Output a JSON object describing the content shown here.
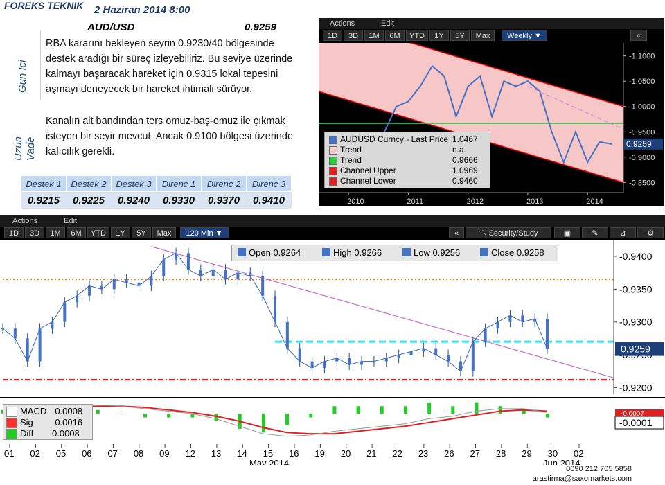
{
  "header": {
    "brand": "FOREKS TEKNIK",
    "date": "2 Haziran 2014 8:00",
    "pair": "AUD/USD",
    "price": "0.9259"
  },
  "sections": {
    "short_label": "Gun Ici",
    "long_label": "Uzun Vade"
  },
  "commentary": {
    "short": [
      "RBA kararını bekleyen seyrin 0.9230/40 bölgesinde",
      "destek aradığı bir süreç izleyebiliriz. Bu seviye üzerinde",
      "kalmayı başaracak hareket için 0.9315 lokal tepesini",
      "aşmayı deneyecek bir hareket ihtimali sürüyor."
    ],
    "long": [
      "Kanalın alt bandından ters omuz-baş-omuz ile çıkmak",
      "isteyen bir seyir mevcut. Ancak 0.9100 bölgesi üzerinde",
      "kalıcılık gerekli."
    ]
  },
  "levels": {
    "headers": [
      "Destek 1",
      "Destek 2",
      "Destek 3",
      "Direnc 1",
      "Direnc 2",
      "Direnc 3"
    ],
    "values": [
      "0.9215",
      "0.9225",
      "0.9240",
      "0.9330",
      "0.9370",
      "0.9410"
    ]
  },
  "weekly": {
    "menu": [
      "Actions",
      "Edit"
    ],
    "buttons": [
      "1D",
      "3D",
      "1M",
      "6M",
      "YTD",
      "1Y",
      "5Y",
      "Max"
    ],
    "period": "Weekly",
    "collapse": "«",
    "legend": [
      {
        "name": "AUDUSD Curncy - Last Price",
        "value": "1.0467",
        "color": "#4472c4"
      },
      {
        "name": "Trend",
        "value": "n.a.",
        "color": "#f4cccc"
      },
      {
        "name": "Trend",
        "value": "0.9666",
        "color": "#2ecc40"
      },
      {
        "name": "Channel Upper",
        "value": "1.0969",
        "color": "#e02020"
      },
      {
        "name": "Channel Lower",
        "value": "0.9460",
        "color": "#e02020"
      }
    ],
    "y_ticks": [
      "1.1000",
      "1.0500",
      "1.0000",
      "0.9500",
      "0.9000",
      "0.8500"
    ],
    "x_ticks": [
      "2010",
      "2011",
      "2012",
      "2013",
      "2014"
    ],
    "last_tag": "0.9259",
    "colors": {
      "price": "#4472c4",
      "channel": "#ff0000",
      "band": "#f7c6c6",
      "trend": "#2ecc40"
    }
  },
  "intraday": {
    "menu": [
      "Actions",
      "Edit"
    ],
    "buttons": [
      "1D",
      "3D",
      "1M",
      "6M",
      "YTD",
      "1Y",
      "5Y",
      "Max"
    ],
    "period": "120 Min",
    "collapse": "«",
    "security_label": "Security/Study",
    "ohlc": [
      {
        "label": "Open",
        "value": "0.9264"
      },
      {
        "label": "High",
        "value": "0.9266"
      },
      {
        "label": "Low",
        "value": "0.9256"
      },
      {
        "label": "Close",
        "value": "0.9258"
      }
    ],
    "y_ticks": [
      "0.9400",
      "0.9350",
      "0.9300",
      "0.9250",
      "0.9200"
    ],
    "last_tag": "0.9259",
    "x_ticks": [
      "01",
      "02",
      "05",
      "06",
      "07",
      "08",
      "09",
      "12",
      "13",
      "14",
      "15",
      "16",
      "19",
      "20",
      "21",
      "22",
      "23",
      "26",
      "27",
      "28",
      "29",
      "30",
      "02"
    ],
    "month_labels": [
      "May 2014",
      "Jun 2014"
    ],
    "macd_legend": [
      {
        "name": "MACD",
        "value": "-0.0008",
        "color": "#ffffff"
      },
      {
        "name": "Sig",
        "value": "-0.0016",
        "color": "#ff3030"
      },
      {
        "name": "Diff",
        "value": "0.0008",
        "color": "#22cc22"
      }
    ],
    "macd_tag": "-0.0001",
    "macd_tag_small": "-0.0007"
  },
  "contact": {
    "phone": "0090 212 705 5858",
    "email": "arastirma@saxomarkets.com"
  },
  "chart_data": [
    {
      "type": "line",
      "title": "AUDUSD Curncy",
      "period": "Weekly",
      "x": [
        2009.8,
        2010.0,
        2010.2,
        2010.4,
        2010.6,
        2010.8,
        2011.0,
        2011.2,
        2011.4,
        2011.6,
        2011.8,
        2012.0,
        2012.2,
        2012.4,
        2012.6,
        2012.8,
        2013.0,
        2013.2,
        2013.4,
        2013.6,
        2013.8,
        2014.0,
        2014.2,
        2014.4
      ],
      "series": [
        {
          "name": "AUDUSD Curncy - Last Price",
          "values": [
            0.905,
            0.93,
            0.88,
            0.86,
            0.95,
            1.0,
            1.01,
            1.04,
            1.08,
            1.06,
            0.98,
            1.04,
            1.06,
            0.98,
            1.05,
            1.04,
            1.05,
            1.03,
            0.95,
            0.89,
            0.95,
            0.89,
            0.93,
            0.926
          ]
        }
      ],
      "channel_upper": [
        [
          2009.5,
          1.18
        ],
        [
          2014.6,
          1.0
        ]
      ],
      "channel_lower": [
        [
          2009.5,
          1.03
        ],
        [
          2014.6,
          0.85
        ]
      ],
      "trend": 0.9666,
      "ylim": [
        0.83,
        1.12
      ],
      "xlim": [
        2009.5,
        2014.6
      ]
    },
    {
      "type": "line",
      "title": "AUD/USD",
      "period": "120 Min",
      "x": [
        0,
        1,
        2,
        3,
        4,
        5,
        6,
        7,
        8,
        9,
        10,
        11,
        12,
        13,
        14,
        15,
        16,
        17,
        18,
        19,
        20,
        21,
        22,
        23,
        24,
        25,
        26,
        27,
        28,
        29,
        30,
        31,
        32,
        33,
        34,
        35,
        36,
        37,
        38,
        39,
        40,
        41,
        42,
        43,
        44
      ],
      "series": [
        {
          "name": "AUD/USD",
          "values": [
            0.929,
            0.9275,
            0.924,
            0.929,
            0.93,
            0.933,
            0.934,
            0.9355,
            0.935,
            0.9365,
            0.936,
            0.9355,
            0.937,
            0.9395,
            0.9405,
            0.938,
            0.937,
            0.938,
            0.9365,
            0.9375,
            0.937,
            0.934,
            0.93,
            0.926,
            0.924,
            0.923,
            0.924,
            0.9245,
            0.9235,
            0.924,
            0.924,
            0.9245,
            0.925,
            0.9255,
            0.926,
            0.925,
            0.924,
            0.9225,
            0.927,
            0.929,
            0.93,
            0.931,
            0.93,
            0.9305,
            0.9259
          ]
        }
      ],
      "resistance": 0.9365,
      "support": 0.9212,
      "dashed_level": 0.927,
      "ylim": [
        0.919,
        0.942
      ]
    },
    {
      "type": "line",
      "title": "MACD",
      "series": [
        {
          "name": "MACD",
          "values": [
            0.0002,
            0.0004,
            0.0005,
            0.0006,
            0.0007,
            0.0006,
            0.0004,
            0.0002,
            0.0,
            -0.0004,
            -0.001,
            -0.0016,
            -0.0018,
            -0.0017,
            -0.0014,
            -0.0012,
            -0.001,
            -0.0008,
            -0.0004,
            -0.0002,
            0.0002,
            0.0004,
            0.0004,
            0.0001
          ]
        },
        {
          "name": "Sig",
          "values": [
            0.0001,
            0.0003,
            0.0004,
            0.0005,
            0.0006,
            0.0006,
            0.0005,
            0.0003,
            0.0001,
            -0.0002,
            -0.0006,
            -0.0011,
            -0.0015,
            -0.0016,
            -0.0016,
            -0.0014,
            -0.0012,
            -0.001,
            -0.0007,
            -0.0004,
            -0.0001,
            0.0002,
            0.0003,
            0.0002
          ]
        }
      ],
      "ylim": [
        -0.0022,
        0.001
      ]
    }
  ]
}
